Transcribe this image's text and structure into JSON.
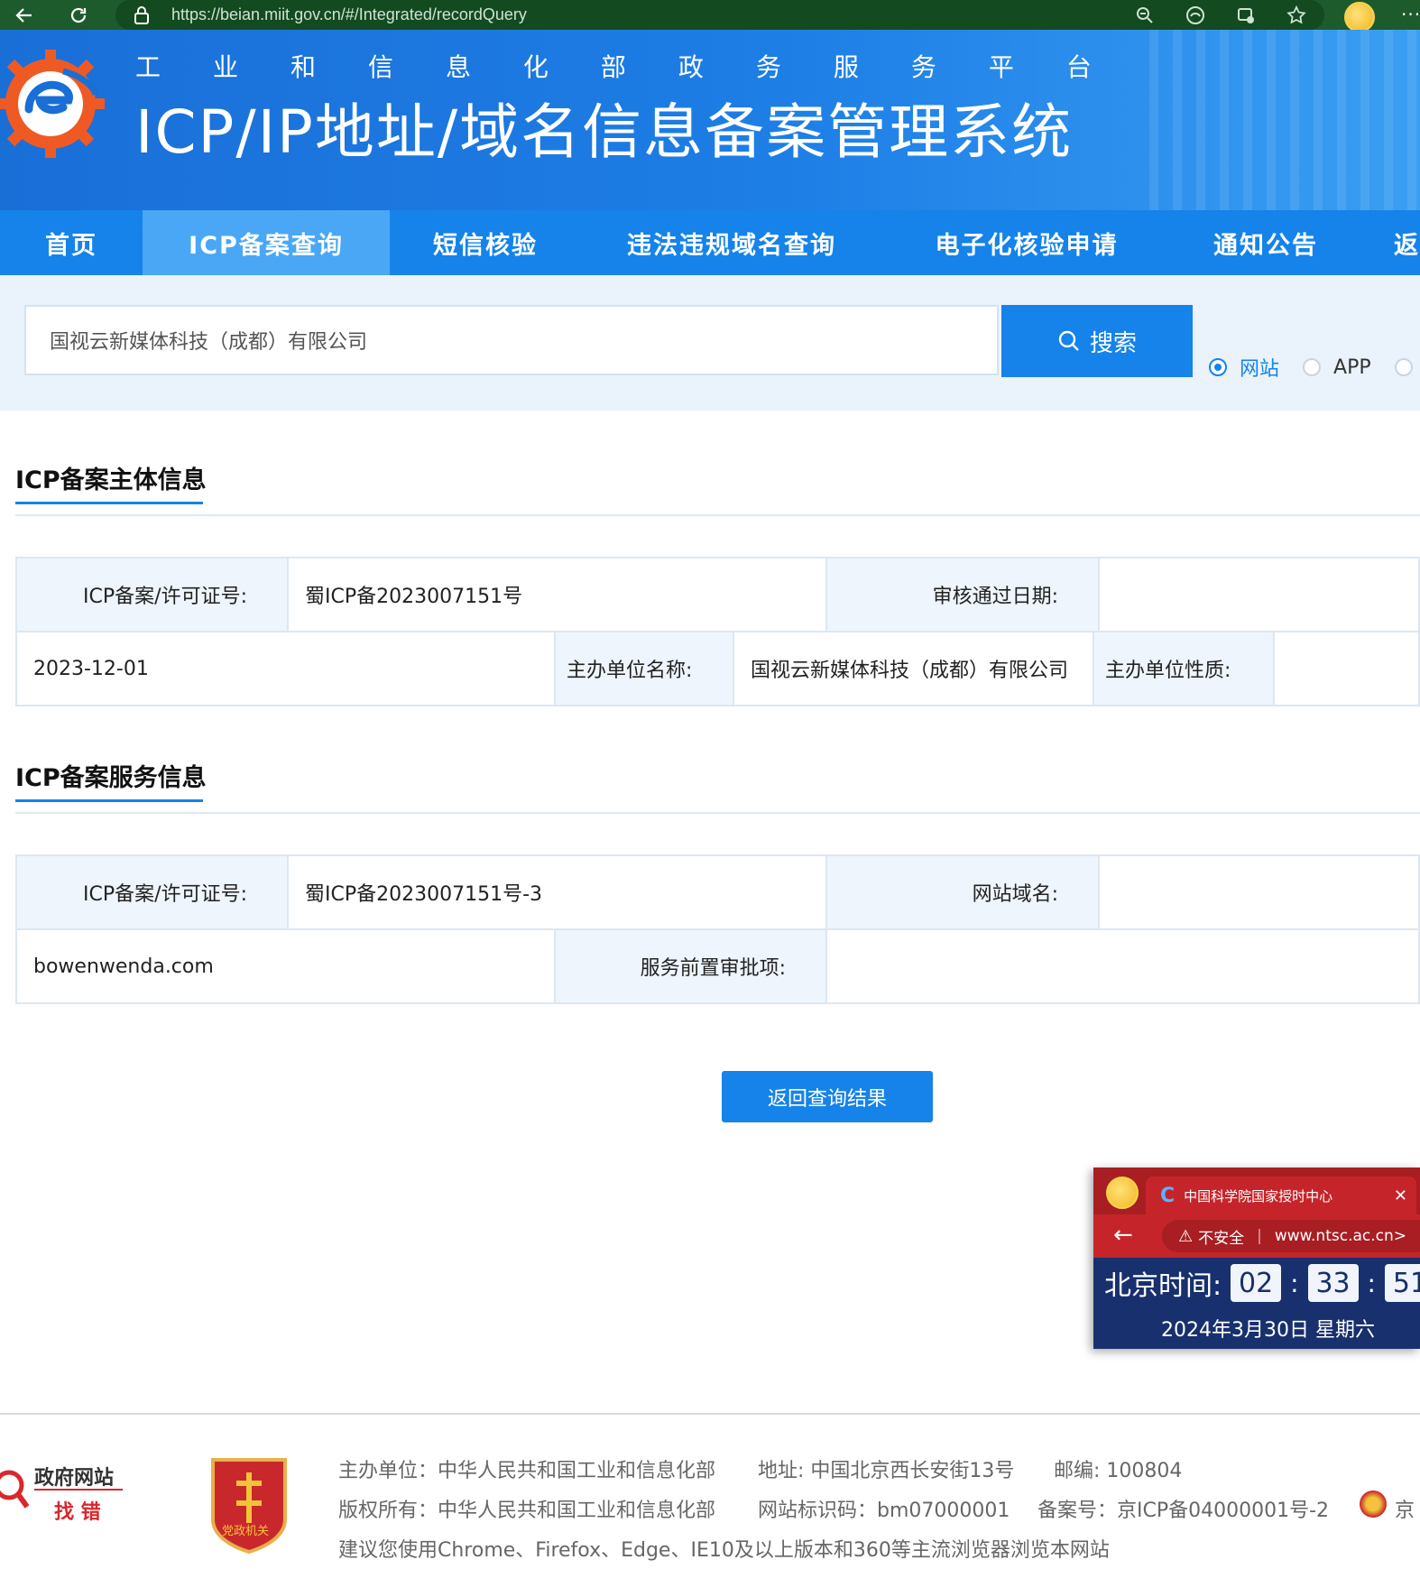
{
  "browser": {
    "url": "https://beian.miit.gov.cn/#/Integrated/recordQuery"
  },
  "header": {
    "ministry_chars": [
      "工",
      "业",
      "和",
      "信",
      "息",
      "化",
      "部",
      "政",
      "务",
      "服",
      "务",
      "平",
      "台"
    ],
    "system_title": "ICP/IP地址/域名信息备案管理系统"
  },
  "nav": {
    "items": [
      {
        "label": "首页"
      },
      {
        "label": "ICP备案查询"
      },
      {
        "label": "短信核验"
      },
      {
        "label": "违法违规域名查询"
      },
      {
        "label": "电子化核验申请"
      },
      {
        "label": "通知公告"
      },
      {
        "label": "返"
      }
    ]
  },
  "search": {
    "value": "国视云新媒体科技（成都）有限公司",
    "button_label": "搜索",
    "options": [
      {
        "label": "网站",
        "selected": true
      },
      {
        "label": "APP",
        "selected": false
      }
    ]
  },
  "subject_info": {
    "title": "ICP备案主体信息",
    "license_label": "ICP备案/许可证号:",
    "license_value": "蜀ICP备2023007151号",
    "date_label": "审核通过日期:",
    "date_value": "2023-12-01",
    "org_name_label": "主办单位名称:",
    "org_name_value": "国视云新媒体科技（成都）有限公司",
    "org_type_label": "主办单位性质:"
  },
  "service_info": {
    "title": "ICP备案服务信息",
    "license_label": "ICP备案/许可证号:",
    "license_value": "蜀ICP备2023007151号-3",
    "domain_label": "网站域名:",
    "domain_value": "bowenwenda.com",
    "approval_label": "服务前置审批项:"
  },
  "back_button_label": "返回查询结果",
  "popup": {
    "tab_title": "中国科学院国家授时中心",
    "insecure_label": "不安全",
    "address": "www.ntsc.ac.cn>",
    "time_label": "北京时间:",
    "hours": "02",
    "minutes": "33",
    "seconds": "51",
    "date": "2024年3月30日 星期六"
  },
  "footer": {
    "gov_error_line1": "政府网站",
    "gov_error_line2": "找 错",
    "party_badge_text": "党政机关",
    "line1": "主办单位：中华人民共和国工业和信息化部",
    "line1_addr": "地址: 中国北京西长安街13号",
    "line1_zip": "邮编: 100804",
    "line2": "版权所有：中华人民共和国工业和信息化部",
    "line2_code": "网站标识码：bm07000001",
    "line2_record": "备案号：京ICP备04000001号-2",
    "line2_extra": "京",
    "line3": "建议您使用Chrome、Firefox、Edge、IE10及以上版本和360等主流浏览器浏览本网站"
  },
  "colors": {
    "accent": "#1583e9",
    "browser_bar": "#1e5b2c",
    "label_bg": "#eef5fc"
  }
}
